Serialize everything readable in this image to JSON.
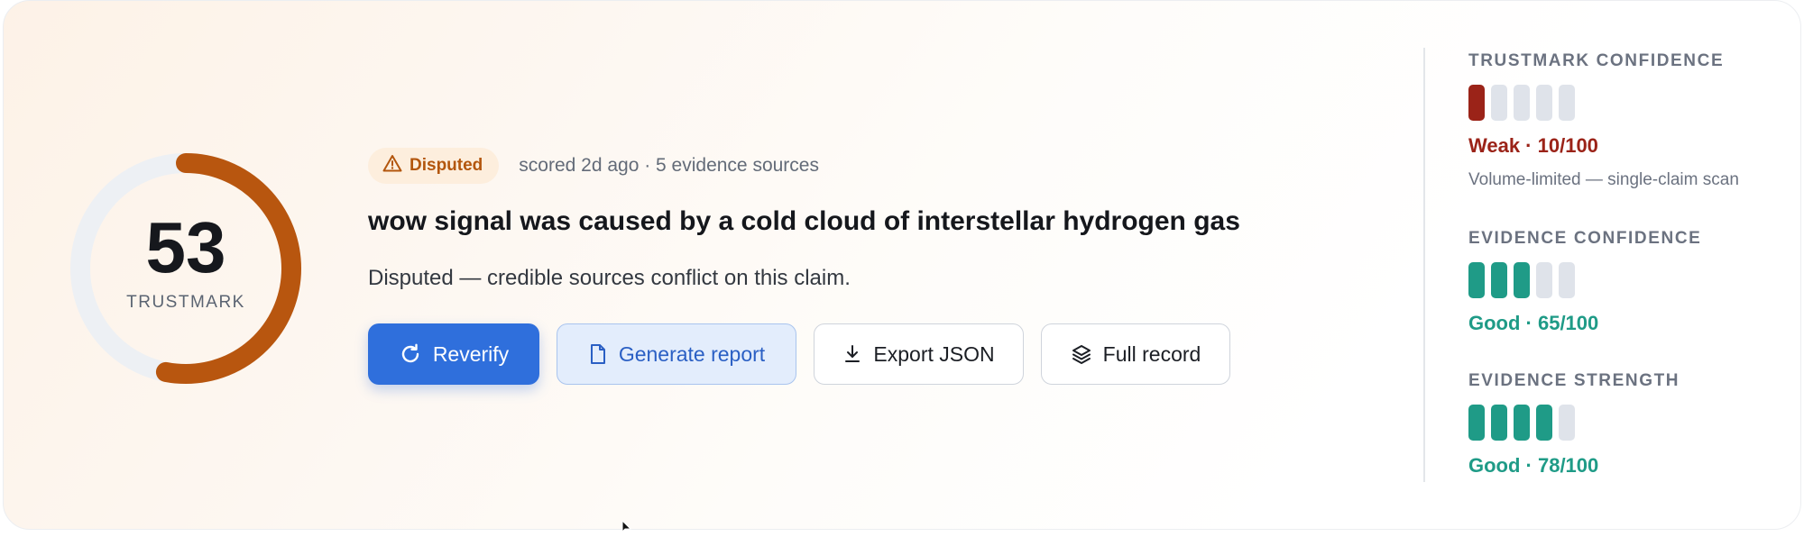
{
  "score": {
    "value": "53",
    "label": "TRUSTMARK",
    "fraction": 0.53,
    "ring_color": "#b8560f",
    "track_color": "#edf0f4"
  },
  "claim": {
    "status_badge": "Disputed",
    "status_icon": "warning-triangle-icon",
    "meta": "scored 2d ago · 5 evidence sources",
    "title": "wow signal was caused by a cold cloud of interstellar hydrogen gas",
    "summary": "Disputed — credible sources conflict on this claim."
  },
  "actions": {
    "reverify": {
      "label": "Reverify",
      "icon": "refresh-icon"
    },
    "generate_report": {
      "label": "Generate report",
      "icon": "document-icon"
    },
    "export_json": {
      "label": "Export JSON",
      "icon": "download-icon"
    },
    "full_record": {
      "label": "Full record",
      "icon": "layers-icon"
    }
  },
  "metrics": [
    {
      "title": "TRUSTMARK CONFIDENCE",
      "filled_bars": 1,
      "total_bars": 5,
      "value_text": "Weak · 10/100",
      "score": 10,
      "color": "#9b2318",
      "note": "Volume-limited — single-claim scan"
    },
    {
      "title": "EVIDENCE CONFIDENCE",
      "filled_bars": 3,
      "total_bars": 5,
      "value_text": "Good · 65/100",
      "score": 65,
      "color": "#1f9b87"
    },
    {
      "title": "EVIDENCE STRENGTH",
      "filled_bars": 4,
      "total_bars": 5,
      "value_text": "Good · 78/100",
      "score": 78,
      "color": "#1f9b87"
    }
  ]
}
